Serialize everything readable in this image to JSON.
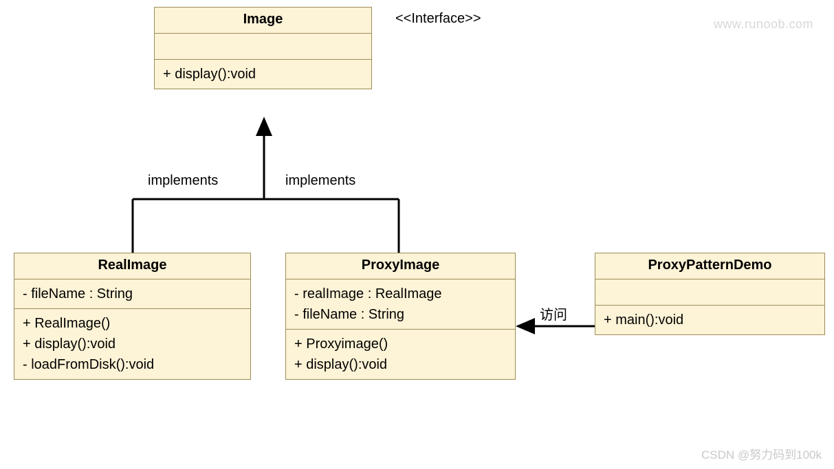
{
  "interface_label": "<<Interface>>",
  "watermark_top": "www.runoob.com",
  "watermark_bottom": "CSDN @努力码到100k",
  "labels": {
    "impl_left": "implements",
    "impl_right": "implements",
    "access": "访问"
  },
  "classes": {
    "image": {
      "name": "Image",
      "attributes": [],
      "methods": [
        "+ display():void"
      ]
    },
    "realimage": {
      "name": "RealImage",
      "attributes": [
        "- fileName : String"
      ],
      "methods": [
        "+ RealImage()",
        "+ display():void",
        "- loadFromDisk():void"
      ]
    },
    "proxyimage": {
      "name": "ProxyImage",
      "attributes": [
        "- realImage : RealImage",
        "- fileName : String"
      ],
      "methods": [
        "+ Proxyimage()",
        "+ display():void"
      ]
    },
    "demo": {
      "name": "ProxyPatternDemo",
      "attributes": [],
      "methods": [
        "+ main():void"
      ]
    }
  }
}
